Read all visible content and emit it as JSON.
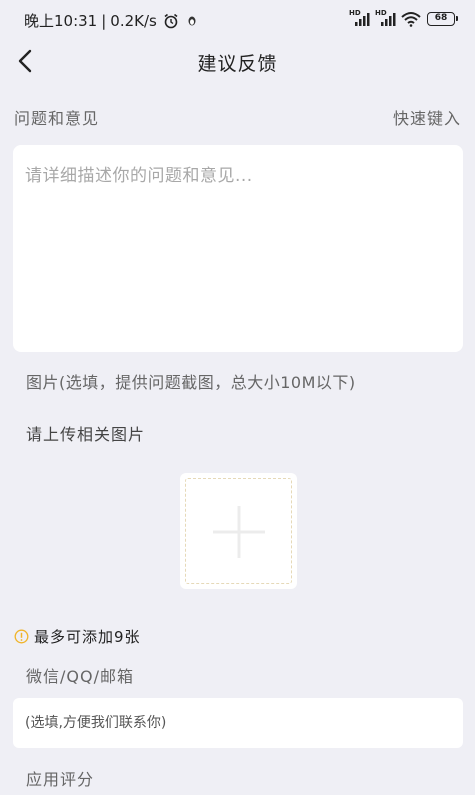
{
  "status_bar": {
    "time": "晚上10:31",
    "separator": "|",
    "speed": "0.2K/s",
    "signal_label_1": "HD",
    "signal_label_2": "HD",
    "battery": "68"
  },
  "nav": {
    "title": "建议反馈"
  },
  "feedback": {
    "section_label": "问题和意见",
    "quick_input_label": "快速键入",
    "placeholder": "请详细描述你的问题和意见..."
  },
  "images": {
    "note": "图片(选填，提供问题截图，总大小10M以下)",
    "upload_label": "请上传相关图片",
    "max_note": "最多可添加9张"
  },
  "contact": {
    "label": "微信/QQ/邮箱",
    "placeholder": "(选填,方便我们联系你)"
  },
  "rating": {
    "label": "应用评分"
  },
  "icons": {
    "back": "chevron-left-icon",
    "alarm": "alarm-clock-icon",
    "wifi": "wifi-icon",
    "info": "info-icon",
    "plus": "plus-icon"
  },
  "colors": {
    "background": "#efeff5",
    "card": "#ffffff",
    "info_accent": "#f0b429",
    "upload_border": "#e6d9b8"
  }
}
